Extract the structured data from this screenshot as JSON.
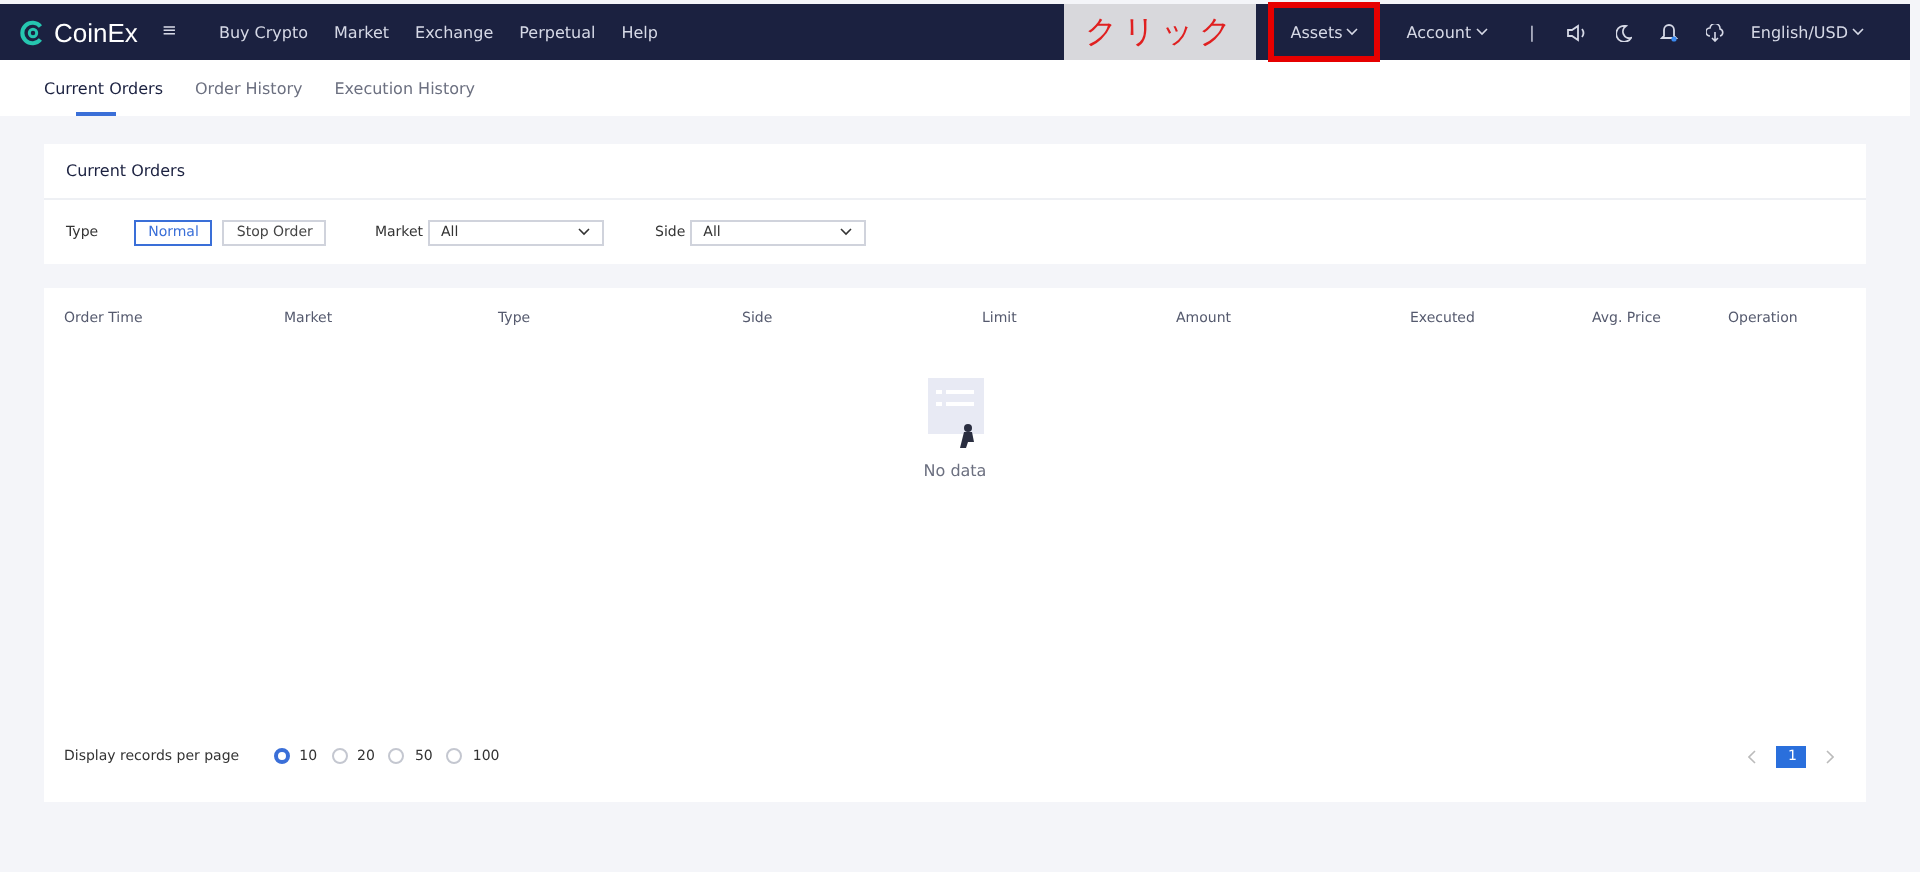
{
  "nav": {
    "logo": "CoinEx",
    "menu_icon": "≡",
    "items": [
      {
        "label": "Buy Crypto",
        "dropdown": false
      },
      {
        "label": "Market",
        "dropdown": false
      },
      {
        "label": "Exchange",
        "dropdown": false
      },
      {
        "label": "Perpetual",
        "dropdown": false
      },
      {
        "label": "Help",
        "dropdown": false
      }
    ],
    "annotation": "クリック",
    "right_items": [
      {
        "label": "Assets",
        "highlighted": true
      },
      {
        "label": "Account",
        "highlighted": false
      }
    ],
    "separator": "|",
    "language": "English/USD"
  },
  "tabs": [
    {
      "label": "Current Orders",
      "selected": true
    },
    {
      "label": "Order History",
      "selected": false
    },
    {
      "label": "Execution History",
      "selected": false
    }
  ],
  "filter_card": {
    "title": "Current Orders",
    "type_label": "Type",
    "type_options": [
      {
        "label": "Normal",
        "selected": true
      },
      {
        "label": "Stop Order",
        "selected": false
      }
    ],
    "market_label": "Market",
    "market_value": "All",
    "side_label": "Side",
    "side_value": "All"
  },
  "table": {
    "columns": [
      "Order Time",
      "Market",
      "Type",
      "Side",
      "Limit",
      "Amount",
      "Executed",
      "Avg. Price",
      "Operation"
    ],
    "empty_text": "No data"
  },
  "footer": {
    "per_page_label": "Display records per page",
    "per_page_options": [
      {
        "label": "10",
        "selected": true
      },
      {
        "label": "20",
        "selected": false
      },
      {
        "label": "50",
        "selected": false
      },
      {
        "label": "100",
        "selected": false
      }
    ],
    "pages": [
      {
        "label": "1",
        "selected": true
      }
    ]
  }
}
